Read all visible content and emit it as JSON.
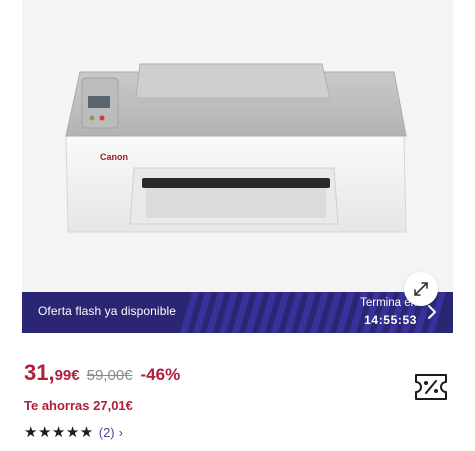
{
  "product_image": {
    "alt_icon": "printer-image",
    "brand_text": "Canon"
  },
  "expand_icon": "expand-icon",
  "flash_banner": {
    "label": "Oferta flash ya disponible",
    "ends_label": "Termina en",
    "time": "14:55:53",
    "chevron_icon": "chevron-right-icon"
  },
  "price": {
    "integer": "31,",
    "decimal": "99€",
    "old": "59,00€",
    "discount": "-46%"
  },
  "savings": "Te ahorras 27,01€",
  "rating": {
    "stars": "★★★★★",
    "value": 5,
    "count": "(2)",
    "chevron": "›"
  },
  "coupon_icon": "coupon-percent-icon",
  "colors": {
    "banner_bg": "#2b2674",
    "price_red": "#b01e3a",
    "link_purple": "#4a47a3"
  }
}
